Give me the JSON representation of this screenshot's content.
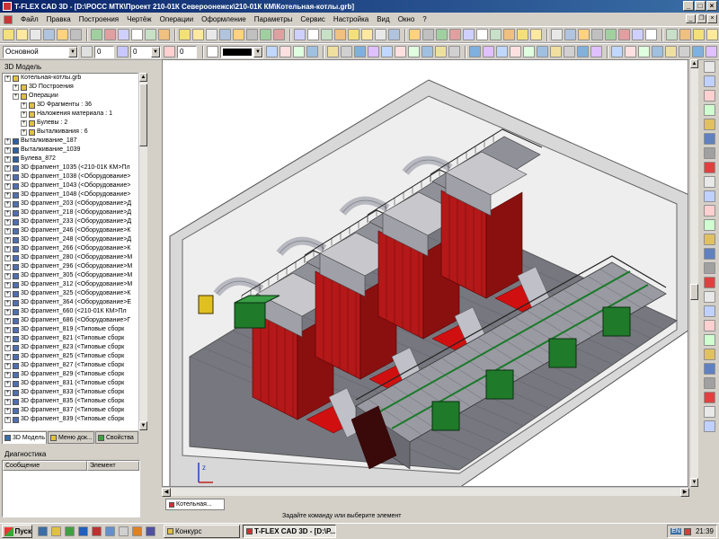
{
  "window": {
    "title": "T-FLEX CAD 3D - [D:\\РОСС МТК\\Проект 210-01К Североонежск\\210-01К КМ\\Котельная-котлы.grb]"
  },
  "menu": [
    "Файл",
    "Правка",
    "Построения",
    "Чертёж",
    "Операции",
    "Оформление",
    "Параметры",
    "Сервис",
    "Настройка",
    "Вид",
    "Окно",
    "?"
  ],
  "toolbar2": {
    "layer": "Основной",
    "value1": "0",
    "value2": "0",
    "value3": "0"
  },
  "model_panel": {
    "title": "3D Модель",
    "items": [
      {
        "label": "Котельная-котлы.grb",
        "level": 0
      },
      {
        "label": "3D Построения",
        "level": 1
      },
      {
        "label": "Операции",
        "level": 1
      },
      {
        "label": "3D Фрагменты : 36",
        "level": 2
      },
      {
        "label": "Наложения материала : 1",
        "level": 2
      },
      {
        "label": "Булевы : 2",
        "level": 2
      },
      {
        "label": "Выталкивания : 6",
        "level": 2
      },
      {
        "label": "Выталкивание_187",
        "level": 0
      },
      {
        "label": "Выталкивание_1039",
        "level": 0
      },
      {
        "label": "Булева_872",
        "level": 0
      },
      {
        "label": "3D фрагмент_1035 (<210-01К КМ>Пл",
        "level": 0
      },
      {
        "label": "3D фрагмент_1038 (<Оборудование>",
        "level": 0
      },
      {
        "label": "3D фрагмент_1043 (<Оборудование>",
        "level": 0
      },
      {
        "label": "3D фрагмент_1048 (<Оборудование>",
        "level": 0
      },
      {
        "label": "3D фрагмент_203 (<Оборудование>Д",
        "level": 0
      },
      {
        "label": "3D фрагмент_218 (<Оборудование>Д",
        "level": 0
      },
      {
        "label": "3D фрагмент_233 (<Оборудование>Д",
        "level": 0
      },
      {
        "label": "3D фрагмент_246 (<Оборудование>К",
        "level": 0
      },
      {
        "label": "3D фрагмент_248 (<Оборудование>Д",
        "level": 0
      },
      {
        "label": "3D фрагмент_266 (<Оборудование>К",
        "level": 0
      },
      {
        "label": "3D фрагмент_280 (<Оборудование>М",
        "level": 0
      },
      {
        "label": "3D фрагмент_296 (<Оборудование>М",
        "level": 0
      },
      {
        "label": "3D фрагмент_305 (<Оборудование>М",
        "level": 0
      },
      {
        "label": "3D фрагмент_312 (<Оборудование>М",
        "level": 0
      },
      {
        "label": "3D фрагмент_325 (<Оборудование>К",
        "level": 0
      },
      {
        "label": "3D фрагмент_364 (<Оборудование>Е",
        "level": 0
      },
      {
        "label": "3D фрагмент_660 (<210-01К КМ>Пл",
        "level": 0
      },
      {
        "label": "3D фрагмент_686 (<Оборудование>Г",
        "level": 0
      },
      {
        "label": "3D фрагмент_819 (<Типовые сборк",
        "level": 0
      },
      {
        "label": "3D фрагмент_821 (<Типовые сборк",
        "level": 0
      },
      {
        "label": "3D фрагмент_823 (<Типовые сборк",
        "level": 0
      },
      {
        "label": "3D фрагмент_825 (<Типовые сборк",
        "level": 0
      },
      {
        "label": "3D фрагмент_827 (<Типовые сборк",
        "level": 0
      },
      {
        "label": "3D фрагмент_829 (<Типовые сборк",
        "level": 0
      },
      {
        "label": "3D фрагмент_831 (<Типовые сборк",
        "level": 0
      },
      {
        "label": "3D фрагмент_833 (<Типовые сборк",
        "level": 0
      },
      {
        "label": "3D фрагмент_835 (<Типовые сборк",
        "level": 0
      },
      {
        "label": "3D фрагмент_837 (<Типовые сборк",
        "level": 0
      },
      {
        "label": "3D фрагмент_839 (<Типовые сборк",
        "level": 0
      }
    ],
    "tabs": [
      "3D Модель",
      "Меню док...",
      "Свойства"
    ]
  },
  "diagnostics": {
    "title": "Диагностика",
    "col_message": "Сообщение",
    "col_element": "Элемент"
  },
  "document_tab": "Котельная...",
  "status": "Задайте команду или выберите элемент",
  "taskbar": {
    "start": "Пуск",
    "tasks": [
      "Конкурс",
      "T-FLEX CAD 3D - [D:\\P..."
    ],
    "lang": "EN",
    "clock": "21:39"
  },
  "axis_label": "z",
  "colors": {
    "title_start": "#0a246a",
    "title_end": "#3a6ea5",
    "boiler_red": "#b41818",
    "floor_gray": "#77777f",
    "equipment_green": "#1f7a2a"
  }
}
